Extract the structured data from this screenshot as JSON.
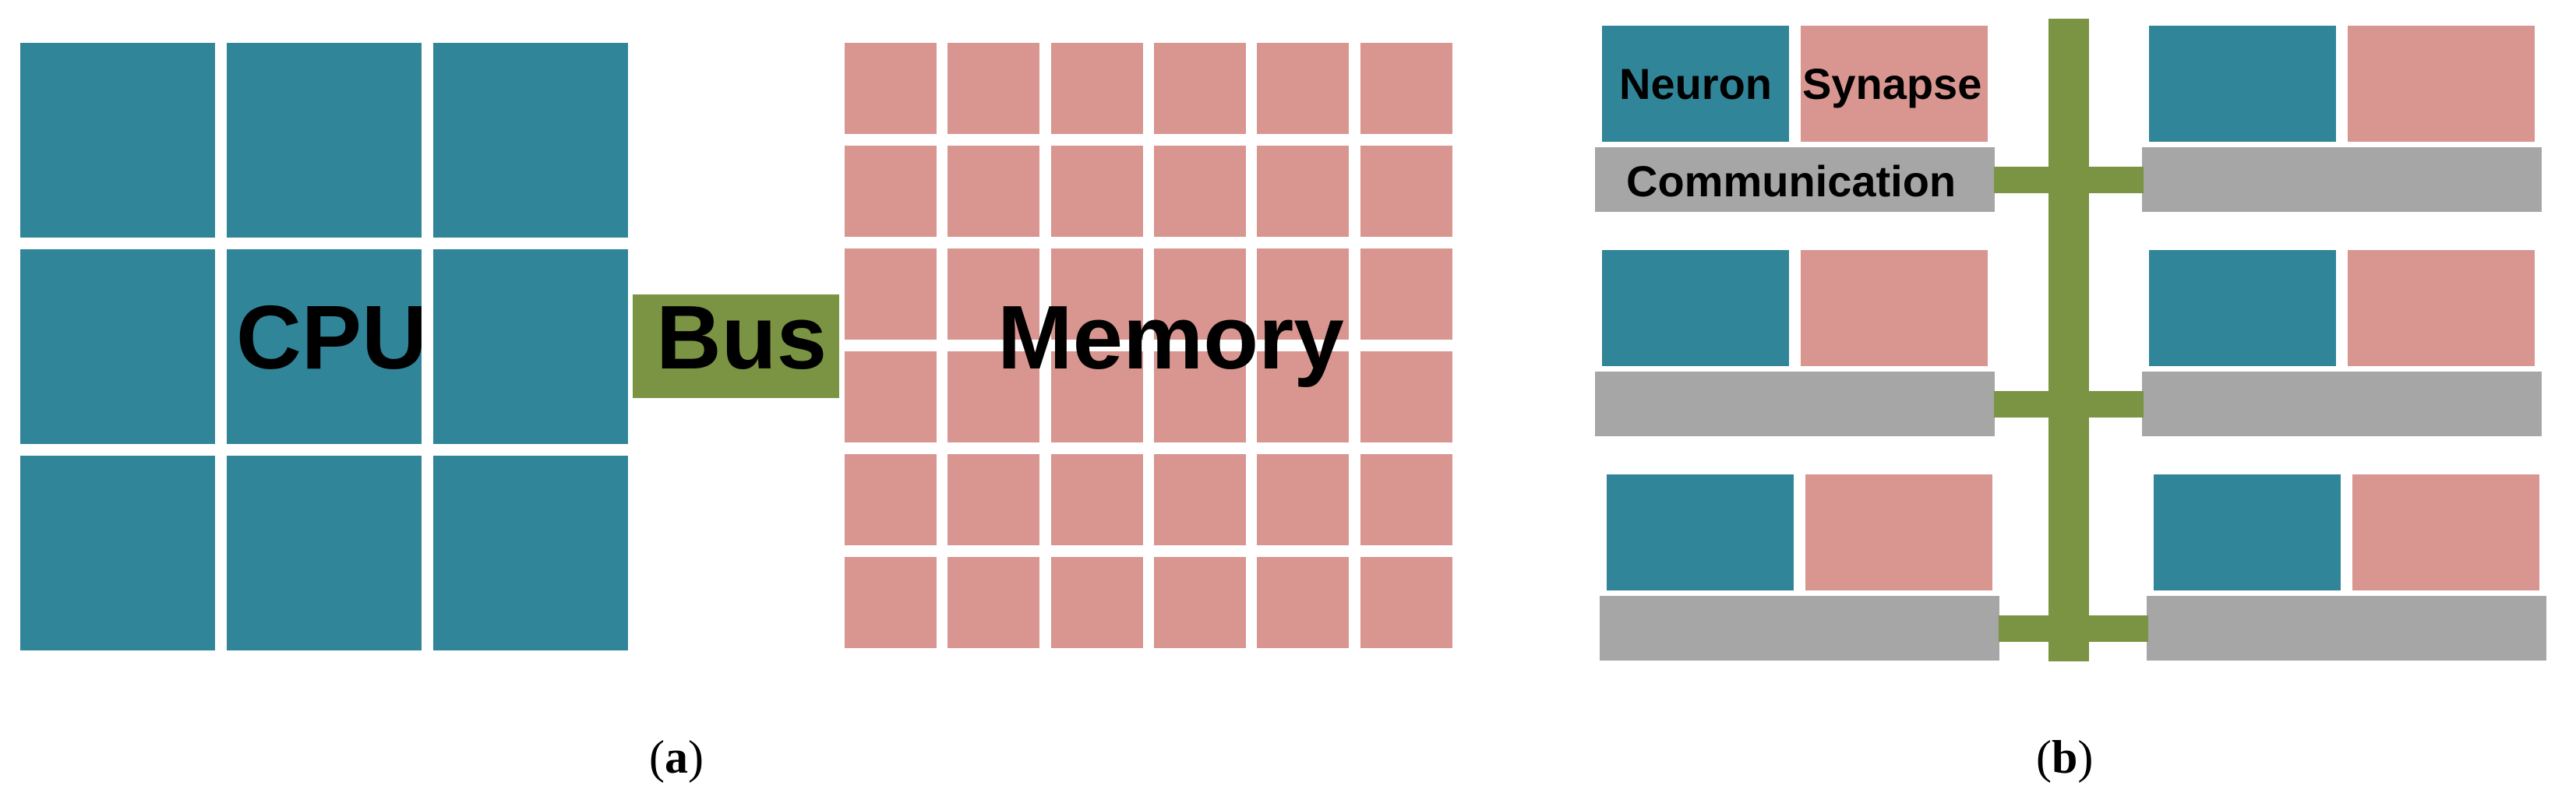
{
  "colors": {
    "cpu": "#318599",
    "memory": "#d99590",
    "bus": "#7a9443",
    "neuron": "#318599",
    "synapse": "#d99590",
    "communication": "#a6a6a6"
  },
  "panel_a": {
    "caption_open": "(",
    "caption_letter": "a",
    "caption_close": ")",
    "cpu": {
      "label": "CPU",
      "grid_rows": 3,
      "grid_cols": 3
    },
    "bus": {
      "label": "Bus"
    },
    "memory": {
      "label": "Memory",
      "grid_rows": 6,
      "grid_cols": 6
    }
  },
  "panel_b": {
    "caption_open": "(",
    "caption_letter": "b",
    "caption_close": ")",
    "module_rows": 3,
    "modules_per_row": 2,
    "labels": {
      "neuron": "Neuron",
      "synapse": "Synapse",
      "communication": "Communication"
    }
  }
}
